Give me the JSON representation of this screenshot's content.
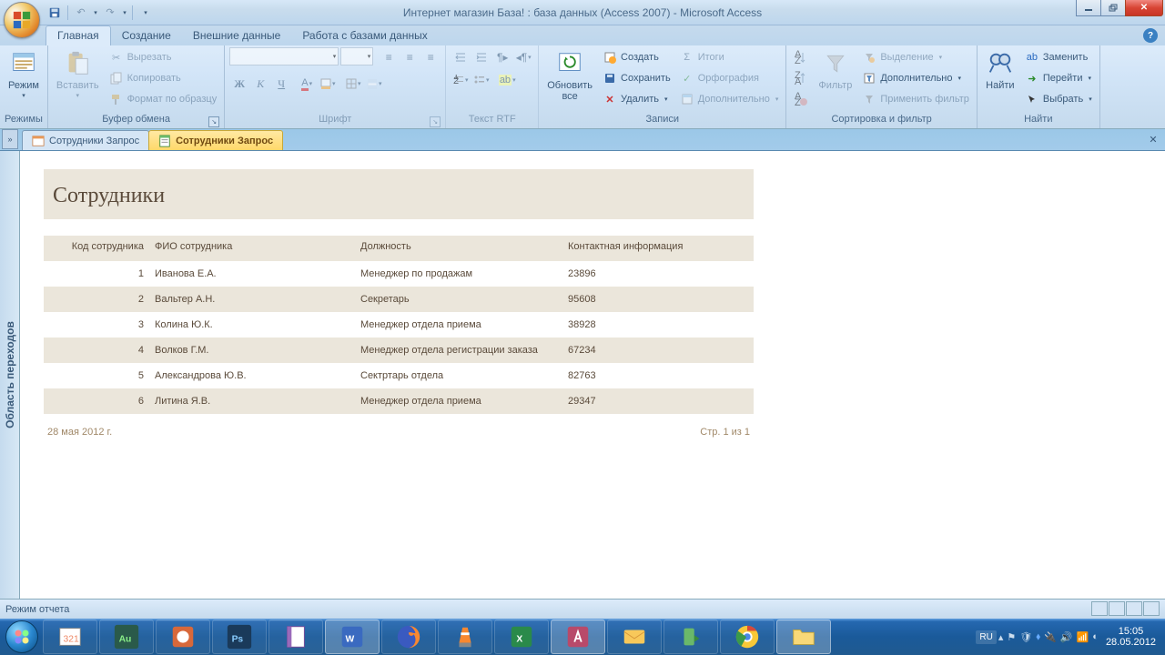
{
  "title": "Интернет магазин База! : база данных (Access 2007) - Microsoft Access",
  "tabs": {
    "home": "Главная",
    "create": "Создание",
    "external": "Внешние данные",
    "dbtools": "Работа с базами данных"
  },
  "groups": {
    "views": "Режимы",
    "viewbtn": "Режим",
    "clipboard": "Буфер обмена",
    "paste": "Вставить",
    "cut": "Вырезать",
    "copy": "Копировать",
    "fmtpaint": "Формат по образцу",
    "font": "Шрифт",
    "richtext": "Текст RTF",
    "refresh": "Обновить\nвсе",
    "records": "Записи",
    "new": "Создать",
    "save": "Сохранить",
    "delete": "Удалить",
    "totals": "Итоги",
    "spell": "Орфография",
    "more": "Дополнительно",
    "sortfilter": "Сортировка и фильтр",
    "filter": "Фильтр",
    "selection": "Выделение",
    "advanced": "Дополнительно",
    "togglef": "Применить фильтр",
    "find": "Найти",
    "findbtn": "Найти",
    "replace": "Заменить",
    "goto": "Перейти",
    "select": "Выбрать"
  },
  "doctabs": {
    "t1": "Сотрудники Запрос",
    "t2": "Сотрудники Запрос"
  },
  "navpane": "Область переходов",
  "report": {
    "title": "Сотрудники",
    "cols": {
      "c1": "Код сотрудника",
      "c2": "ФИО сотрудника",
      "c3": "Должность",
      "c4": "Контактная информация"
    },
    "rows": [
      {
        "id": "1",
        "name": "Иванова Е.А.",
        "pos": "Менеджер по продажам",
        "contact": "23896"
      },
      {
        "id": "2",
        "name": "Вальтер А.Н.",
        "pos": "Секретарь",
        "contact": "95608"
      },
      {
        "id": "3",
        "name": "Колина Ю.К.",
        "pos": "Менеджер отдела приема",
        "contact": "38928"
      },
      {
        "id": "4",
        "name": "Волков Г.М.",
        "pos": "Менеджер отдела регистрации заказа",
        "contact": "67234"
      },
      {
        "id": "5",
        "name": "Александрова Ю.В.",
        "pos": "Сектртарь отдела",
        "contact": "82763"
      },
      {
        "id": "6",
        "name": "Литина Я.В.",
        "pos": "Менеджер отдела приема",
        "contact": "29347"
      }
    ],
    "date": "28 мая 2012 г.",
    "page": "Стр. 1 из 1"
  },
  "status": "Режим отчета",
  "tray": {
    "lang": "RU",
    "time": "15:05",
    "date": "28.05.2012"
  }
}
